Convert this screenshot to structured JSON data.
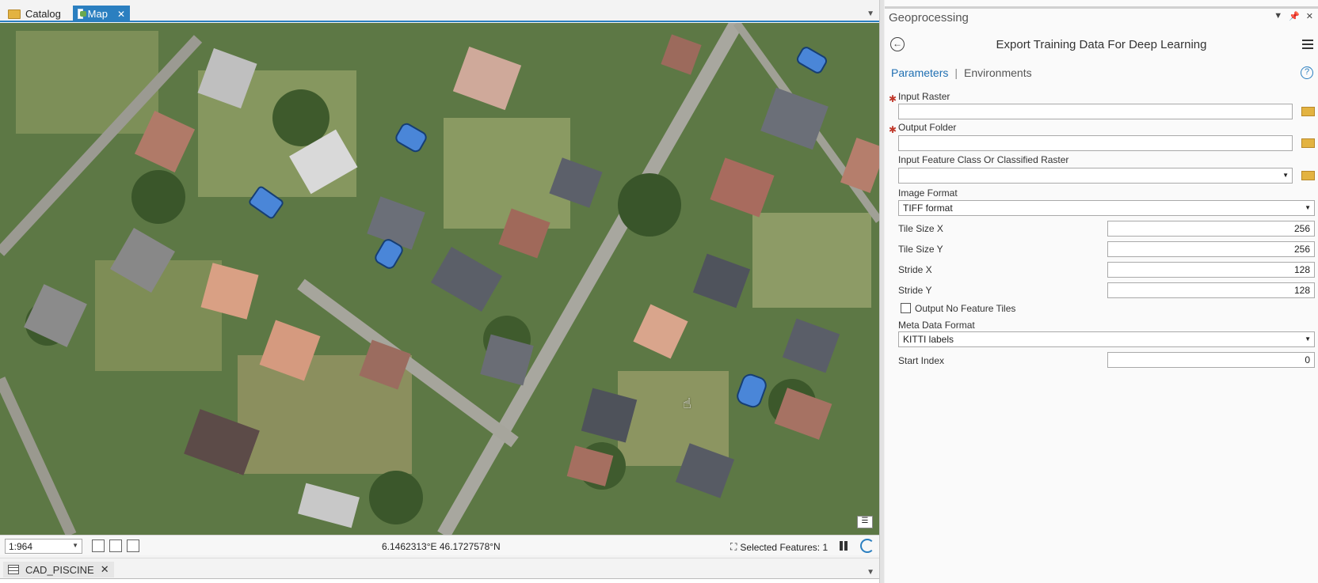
{
  "tabs": {
    "catalog_label": "Catalog",
    "map_label": "Map"
  },
  "status": {
    "scale": "1:964",
    "coordinates": "6.1462313°E 46.1727578°N",
    "selected_features": "Selected Features: 1"
  },
  "bottom_tab": {
    "label": "CAD_PISCINE"
  },
  "geoprocessing": {
    "pane_title": "Geoprocessing",
    "tool_title": "Export Training Data For Deep Learning",
    "tab_parameters": "Parameters",
    "tab_environments": "Environments",
    "params": {
      "input_raster_label": "Input Raster",
      "input_raster_value": "",
      "output_folder_label": "Output Folder",
      "output_folder_value": "",
      "input_feature_label": "Input Feature Class Or Classified Raster",
      "input_feature_value": "",
      "image_format_label": "Image Format",
      "image_format_value": "TIFF format",
      "tile_size_x_label": "Tile Size X",
      "tile_size_x_value": "256",
      "tile_size_y_label": "Tile Size Y",
      "tile_size_y_value": "256",
      "stride_x_label": "Stride X",
      "stride_x_value": "128",
      "stride_y_label": "Stride Y",
      "stride_y_value": "128",
      "output_no_feature_label": "Output No Feature Tiles",
      "output_no_feature_checked": false,
      "meta_format_label": "Meta Data Format",
      "meta_format_value": "KITTI labels",
      "start_index_label": "Start Index",
      "start_index_value": "0"
    }
  },
  "colors": {
    "accent": "#2b7fc0",
    "pool_fill": "#4a86d8",
    "required": "#c0392b"
  },
  "icons": [
    "folder-icon",
    "map-icon",
    "close-icon",
    "back-icon",
    "menu-icon",
    "help-icon",
    "table-icon",
    "refresh-icon",
    "pause-icon"
  ]
}
